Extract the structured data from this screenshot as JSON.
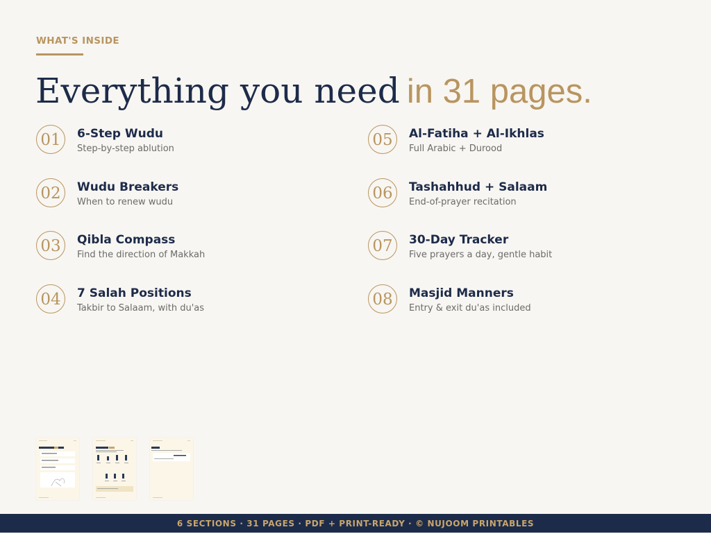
{
  "eyebrow": "WHAT'S INSIDE",
  "headline": {
    "main": "Everything you need",
    "accent": "in 31 pages."
  },
  "items": [
    {
      "num": "01",
      "title": "6-Step Wudu",
      "sub": "Step-by-step ablution"
    },
    {
      "num": "02",
      "title": "Wudu Breakers",
      "sub": "When to renew wudu"
    },
    {
      "num": "03",
      "title": "Qibla Compass",
      "sub": "Find the direction of Makkah"
    },
    {
      "num": "04",
      "title": "7 Salah Positions",
      "sub": "Takbir to Salaam, with du'as"
    },
    {
      "num": "05",
      "title": "Al-Fatiha + Al-Ikhlas",
      "sub": "Full Arabic + Durood"
    },
    {
      "num": "06",
      "title": "Tashahhud + Salaam",
      "sub": "End-of-prayer recitation"
    },
    {
      "num": "07",
      "title": "30-Day Tracker",
      "sub": "Five prayers a day, gentle habit"
    },
    {
      "num": "08",
      "title": "Masjid Manners",
      "sub": "Entry & exit du'as included"
    }
  ],
  "footer": "6 SECTIONS  ·  31 PAGES  ·  PDF + PRINT-READY  ·  © NUJOOM PRINTABLES",
  "colors": {
    "background": "#f8f6f2",
    "navy": "#1d2b4a",
    "gold": "#b89560",
    "muted": "#6b6b6b"
  }
}
